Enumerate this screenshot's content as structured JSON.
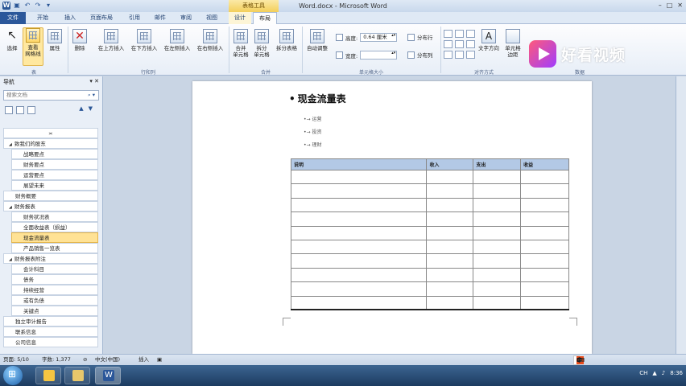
{
  "window": {
    "title": "Word.docx - Microsoft Word",
    "context_tools": "表格工具",
    "controls": [
      "–",
      "□",
      "✕"
    ]
  },
  "tabs": [
    {
      "label": "文件",
      "kind": "file"
    },
    {
      "label": "开始",
      "kind": "normal"
    },
    {
      "label": "插入",
      "kind": "normal"
    },
    {
      "label": "页面布局",
      "kind": "normal"
    },
    {
      "label": "引用",
      "kind": "normal"
    },
    {
      "label": "邮件",
      "kind": "normal"
    },
    {
      "label": "审阅",
      "kind": "normal"
    },
    {
      "label": "视图",
      "kind": "normal"
    },
    {
      "label": "设计",
      "kind": "ctx"
    },
    {
      "label": "布局",
      "kind": "active"
    }
  ],
  "ribbon": {
    "select": "选择",
    "view_gridlines": "查看\n网格线",
    "properties": "属性",
    "group_table": "表",
    "delete": "删除",
    "insert_above": "在上方插入",
    "insert_below": "在下方插入",
    "insert_left": "在左侧插入",
    "insert_right": "在右侧插入",
    "group_rows_cols": "行和列",
    "merge_cells": "合并\n单元格",
    "split_cells": "拆分\n单元格",
    "split_table": "拆分表格",
    "group_merge": "合并",
    "autofit": "自动调整",
    "height_label": "高度:",
    "height_value": "0.64 厘米",
    "width_label": "宽度:",
    "width_value": "",
    "distribute_rows": "分布行",
    "distribute_cols": "分布列",
    "group_cell_size": "单元格大小",
    "text_direction": "文字方向",
    "cell_margins": "单元格\n边距",
    "group_alignment": "对齐方式",
    "group_data": "数据"
  },
  "watermark": "好看视频",
  "nav": {
    "title": "导航",
    "search_placeholder": "搜索文档",
    "items": [
      {
        "label": "≍",
        "level": 0
      },
      {
        "label": "致我们的股东",
        "level": 1,
        "expanded": true
      },
      {
        "label": "战略要点",
        "level": 2
      },
      {
        "label": "财务要点",
        "level": 2
      },
      {
        "label": "运营要点",
        "level": 2
      },
      {
        "label": "展望未来",
        "level": 2
      },
      {
        "label": "财务概要",
        "level": 1
      },
      {
        "label": "财务报表",
        "level": 1,
        "expanded": true
      },
      {
        "label": "财务状况表",
        "level": 2
      },
      {
        "label": "全面收益表（损益）",
        "level": 2
      },
      {
        "label": "现金流量表",
        "level": 2,
        "active": true
      },
      {
        "label": "产品销售一览表",
        "level": 2
      },
      {
        "label": "财务报表附注",
        "level": 1,
        "expanded": true
      },
      {
        "label": "会计科目",
        "level": 2
      },
      {
        "label": "债务",
        "level": 2
      },
      {
        "label": "持续经营",
        "level": 2
      },
      {
        "label": "或有负债",
        "level": 2
      },
      {
        "label": "关键点",
        "level": 2
      },
      {
        "label": "独立审计报告",
        "level": 1
      },
      {
        "label": "联系信息",
        "level": 1
      },
      {
        "label": "公司信息",
        "level": 1
      }
    ]
  },
  "doc": {
    "title": "现金流量表",
    "bullets": [
      "运营",
      "投资",
      "理财"
    ],
    "table": {
      "headers": [
        "说明",
        "收入",
        "支出",
        "收益"
      ],
      "row_count": 10
    }
  },
  "status": {
    "page": "页面: 5/10",
    "words": "字数: 1,377",
    "language": "中文(中国)",
    "mode": "插入",
    "ime": [
      "S",
      "中",
      "·",
      "☾",
      "☺",
      "⌨",
      "♂",
      "⚙"
    ]
  },
  "tray": {
    "lang": "CH",
    "time": "8:36"
  },
  "colors": {
    "file_tab": "#2b579a",
    "active_nav": "#ffe295",
    "table_header": "#b3c9e6",
    "taskbar": "#1c3b60"
  }
}
